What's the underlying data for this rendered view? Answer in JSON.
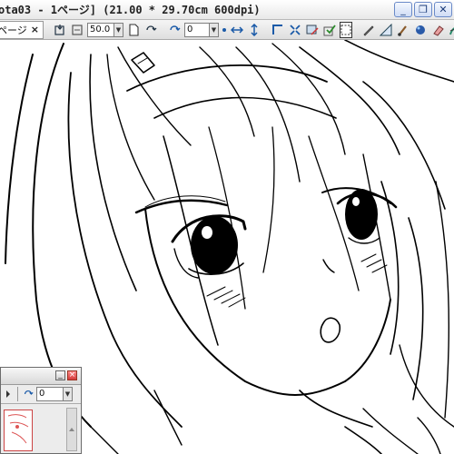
{
  "window": {
    "title": "ota03 - 1ページ] (21.00 * 29.70cm 600dpi)",
    "minimize_glyph": "_",
    "restore_glyph": "❐",
    "close_glyph": "✕"
  },
  "toolbar": {
    "tab_label": "ページ",
    "tab_close": "×",
    "zoom_value": "50.0",
    "rotation_value": "0",
    "icons": [
      "back-icon",
      "reset-zoom-icon",
      "zoom-field",
      "page-icon",
      "rotate-icon",
      "rotation-field",
      "flip-horizontal-icon",
      "flip-vertical-icon",
      "select-tool-icon",
      "transform-icon",
      "pen-tool-icon",
      "brush-tool-icon",
      "eraser-icon",
      "fill-icon",
      "gradient-icon",
      "pattern-icon"
    ]
  },
  "navigator_panel": {
    "rotation_value": "0"
  },
  "colors": {
    "canvas": "#ffffff",
    "lineart": "#000000",
    "toolbar_bg": "#e6e6e6",
    "close_red": "#d43b3b"
  }
}
